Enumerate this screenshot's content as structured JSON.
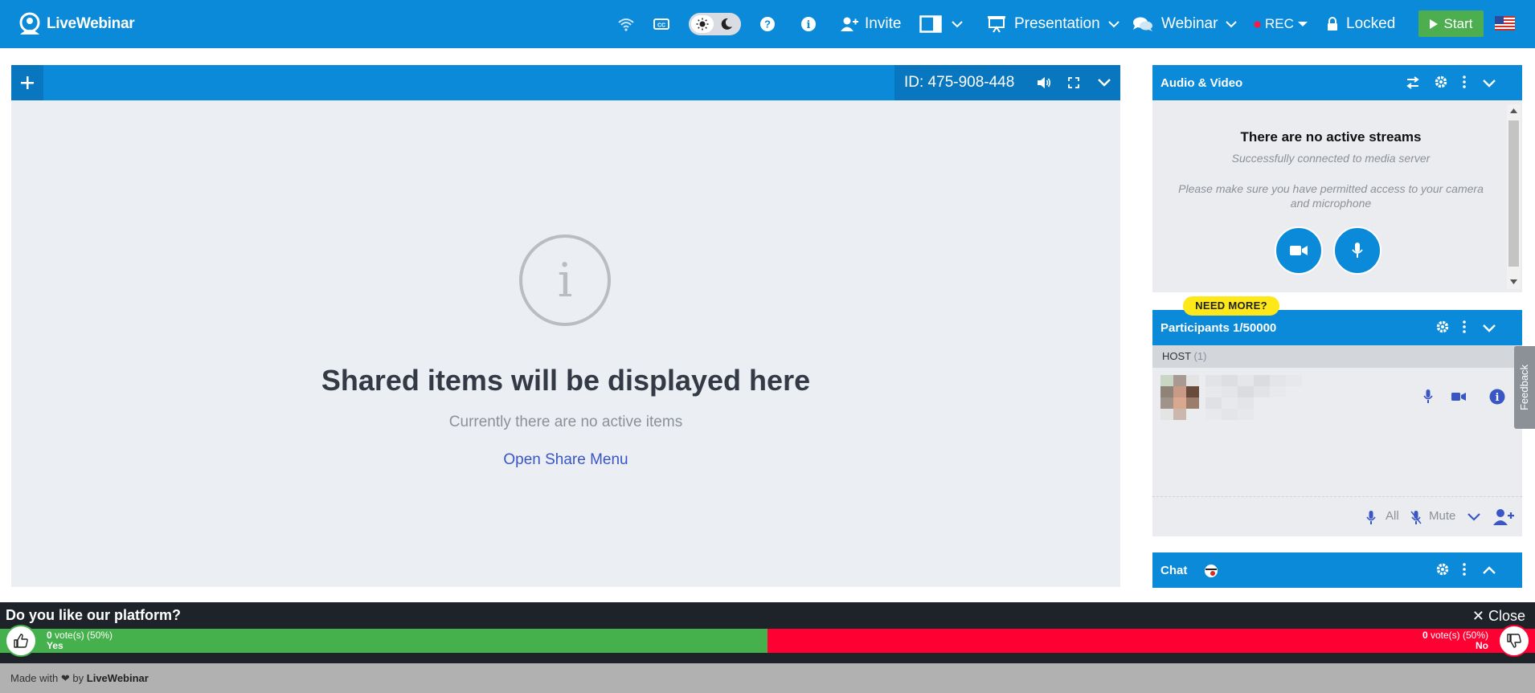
{
  "app": {
    "logo_text": "LiveWebinar"
  },
  "topbar": {
    "icons": [
      "wifi-icon",
      "cc-icon",
      "sun-icon",
      "moon-icon",
      "help-icon",
      "info-icon",
      "layout-icon"
    ],
    "invite_label": "Invite",
    "presentation_label": "Presentation",
    "webinar_label": "Webinar",
    "rec_label": "REC",
    "locked_label": "Locked",
    "start_label": "Start",
    "colors": {
      "bar": "#0a8ad8",
      "start": "#4cae4f",
      "rec_dot": "#ff1744"
    }
  },
  "stage": {
    "room_id": "ID: 475-908-448",
    "title": "Shared items will be displayed here",
    "subtitle": "Currently there are no active items",
    "link": "Open Share Menu"
  },
  "audio_video": {
    "title": "Audio & Video",
    "empty_title": "There are no active streams",
    "empty_sub": "Successfully connected to media server",
    "note": "Please make sure you have permitted access to your camera and microphone"
  },
  "participants": {
    "badge": "NEED MORE?",
    "title": "Participants 1/50000",
    "host_label": "HOST",
    "host_count": "(1)",
    "all_label": "All",
    "mute_label": "Mute"
  },
  "chat": {
    "title": "Chat"
  },
  "feedback": {
    "label": "Feedback"
  },
  "poll": {
    "question": "Do you like our platform?",
    "close_label": "Close",
    "yes": {
      "count": "0",
      "suffix": "vote(s) (50%)",
      "label": "Yes"
    },
    "no": {
      "count": "0",
      "suffix": "vote(s) (50%)",
      "label": "No"
    },
    "yes_share": 0.5
  },
  "footer": {
    "made_with": "Made with",
    "by": "by",
    "brand": "LiveWebinar"
  }
}
